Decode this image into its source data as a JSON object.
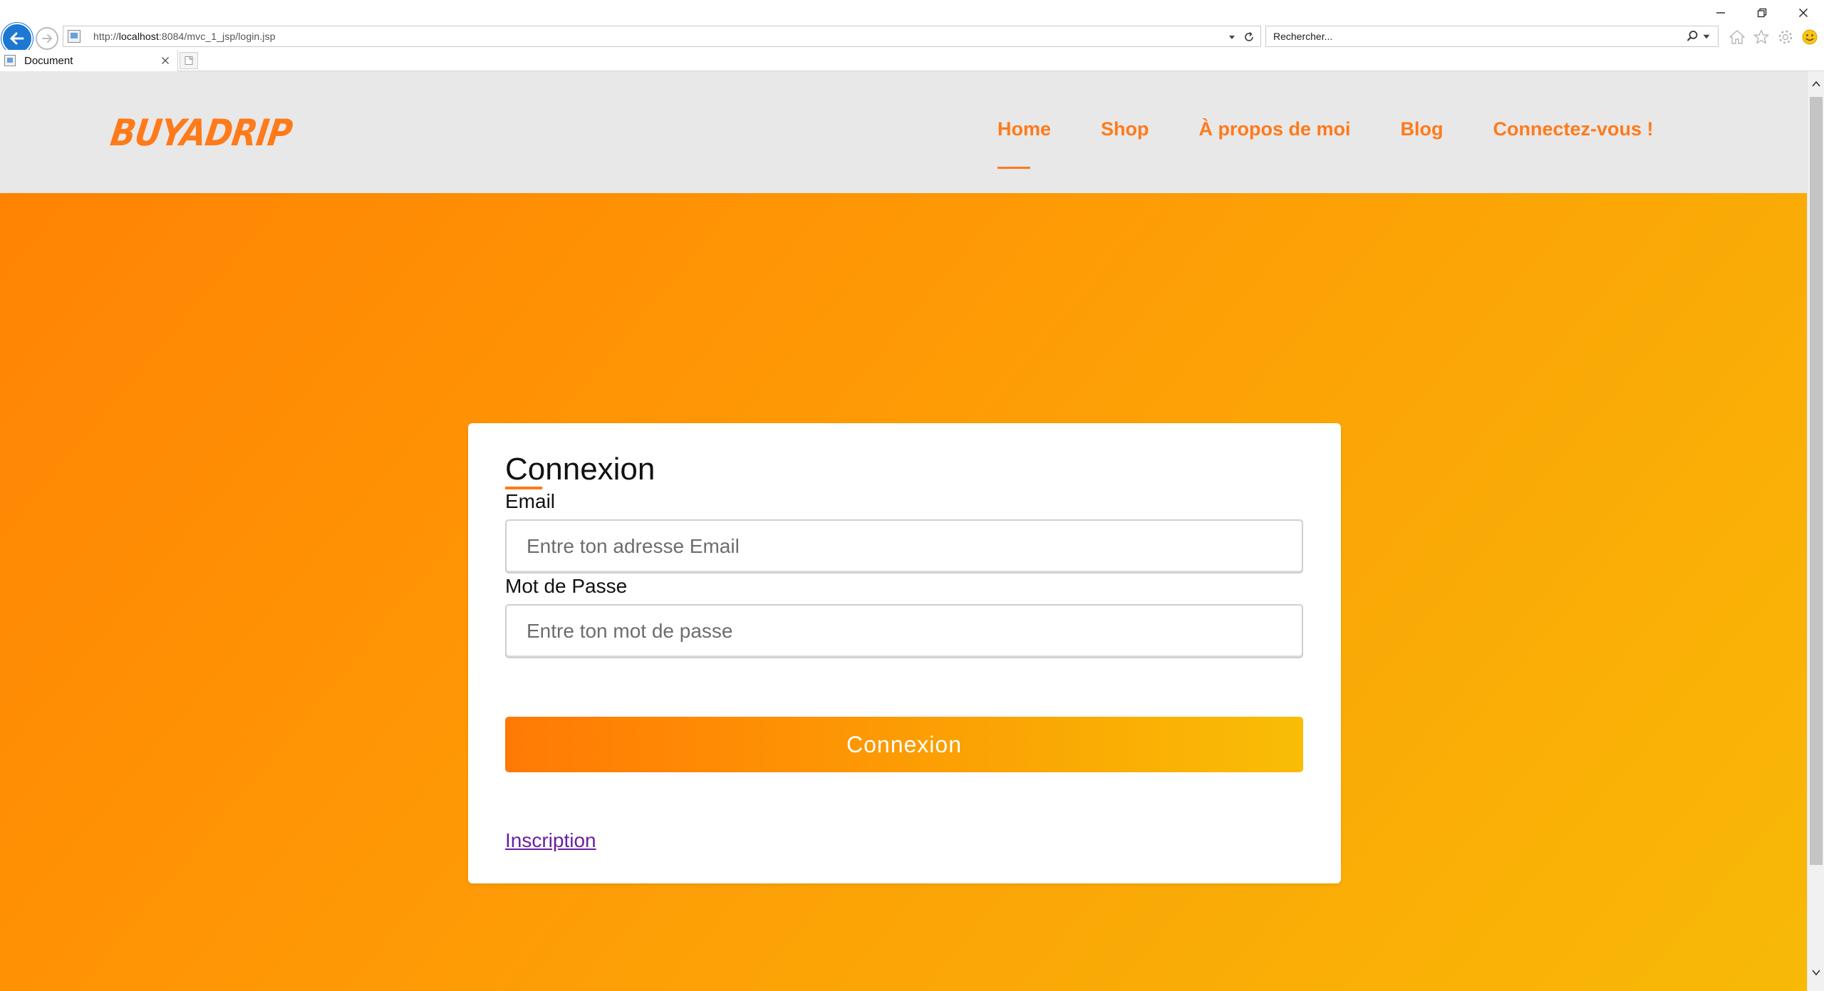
{
  "browser": {
    "url_prefix": "http://",
    "url_host": "localhost",
    "url_rest": ":8084/mvc_1_jsp/login.jsp",
    "search_placeholder": "Rechercher...",
    "tab_title": "Document",
    "icons": {
      "back": "back-arrow-icon",
      "forward": "forward-arrow-icon",
      "refresh": "refresh-icon",
      "home": "home-icon",
      "favorites": "star-icon",
      "settings": "gear-icon",
      "feedback": "smiley-icon"
    },
    "accent_color": "#1e77d3"
  },
  "site": {
    "logo": "BUYADRIP",
    "nav": [
      {
        "label": "Home",
        "active": true
      },
      {
        "label": "Shop",
        "active": false
      },
      {
        "label": "À propos de moi",
        "active": false
      },
      {
        "label": "Blog",
        "active": false
      },
      {
        "label": "Connectez-vous !",
        "active": false
      }
    ],
    "brand_color": "#ff7a1a"
  },
  "login": {
    "title": "Connexion",
    "email_label": "Email",
    "email_placeholder": "Entre ton adresse Email",
    "email_value": "",
    "password_label": "Mot de Passe",
    "password_placeholder": "Entre ton mot de passe",
    "password_value": "",
    "submit_label": "Connexion",
    "signup_link": "Inscription"
  }
}
